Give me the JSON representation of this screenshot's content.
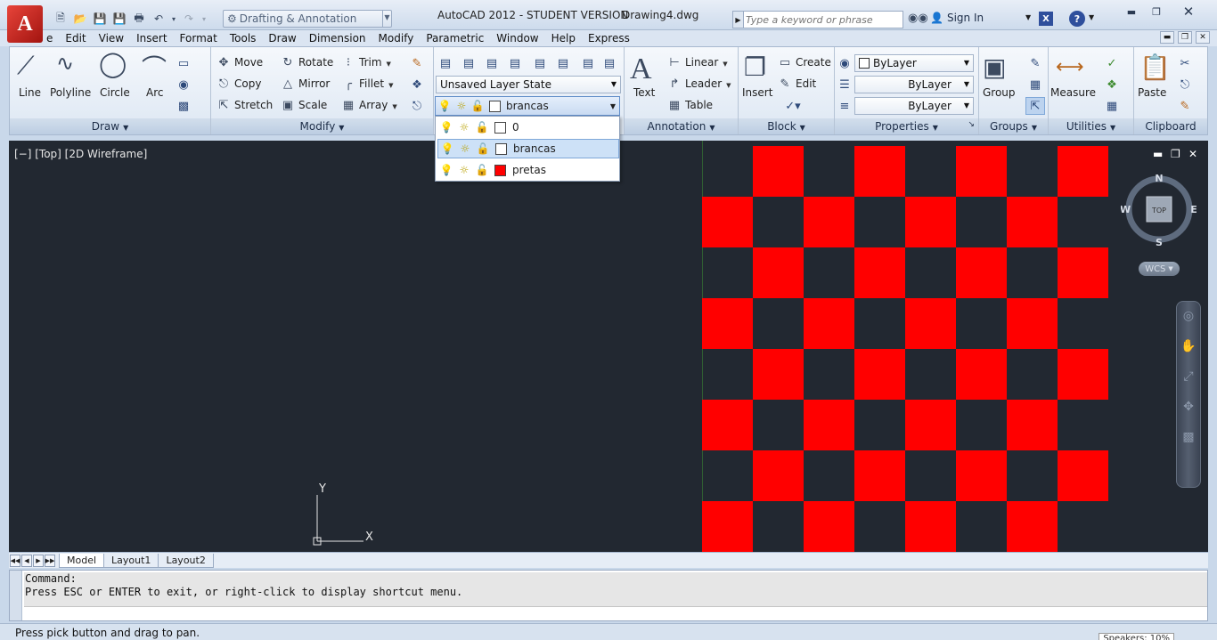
{
  "titlebar": {
    "app_title": "AutoCAD 2012 - STUDENT VERSION",
    "doc_title": "Drawing4.dwg",
    "workspace": "Drafting & Annotation",
    "search_placeholder": "Type a keyword or phrase",
    "sign_in": "Sign In",
    "help": "?",
    "exchange": "X"
  },
  "menubar": [
    "e",
    "Edit",
    "View",
    "Insert",
    "Format",
    "Tools",
    "Draw",
    "Dimension",
    "Modify",
    "Parametric",
    "Window",
    "Help",
    "Express"
  ],
  "ribbon": {
    "draw": {
      "title": "Draw",
      "line": "Line",
      "polyline": "Polyline",
      "circle": "Circle",
      "arc": "Arc"
    },
    "modify": {
      "title": "Modify",
      "move": "Move",
      "rotate": "Rotate",
      "trim": "Trim",
      "copy": "Copy",
      "mirror": "Mirror",
      "fillet": "Fillet",
      "stretch": "Stretch",
      "scale": "Scale",
      "array": "Array"
    },
    "layers": {
      "layer_state": "Unsaved Layer State",
      "current_layer": "brancas"
    },
    "annotation": {
      "title": "Annotation",
      "text": "Text",
      "linear": "Linear",
      "leader": "Leader",
      "table": "Table"
    },
    "block": {
      "title": "Block",
      "insert": "Insert",
      "create": "Create",
      "edit": "Edit"
    },
    "properties": {
      "title": "Properties",
      "color": "ByLayer",
      "linetype": "ByLayer",
      "lineweight": "ByLayer"
    },
    "groups": {
      "title": "Groups",
      "group": "Group"
    },
    "utilities": {
      "title": "Utilities",
      "measure": "Measure"
    },
    "clipboard": {
      "title": "Clipboard",
      "paste": "Paste"
    }
  },
  "layer_dropdown": {
    "items": [
      {
        "name": "0",
        "color": "#ffffff"
      },
      {
        "name": "brancas",
        "color": "#ffffff",
        "selected": true
      },
      {
        "name": "pretas",
        "color": "#ff0000"
      }
    ]
  },
  "viewport": {
    "label": "[−] [Top] [2D Wireframe]",
    "board": {
      "rows": 8,
      "cols": 8,
      "red_color": "#ff0000",
      "dark_color": "#222831"
    },
    "viewcube": {
      "n": "N",
      "s": "S",
      "e": "E",
      "w": "W",
      "face": "TOP"
    },
    "wcs": "WCS",
    "ucs_x": "X",
    "ucs_y": "Y"
  },
  "layout_tabs": [
    "Model",
    "Layout1",
    "Layout2"
  ],
  "command": {
    "line1": "Command:",
    "line2": "Press ESC or ENTER to exit, or right-click to display shortcut menu."
  },
  "status": {
    "message": "Press pick button and drag to pan.",
    "speaker": "Speakers: 10%"
  },
  "colors": {
    "accent": "#2f4f9c",
    "canvas": "#222831",
    "red": "#ff0000"
  }
}
